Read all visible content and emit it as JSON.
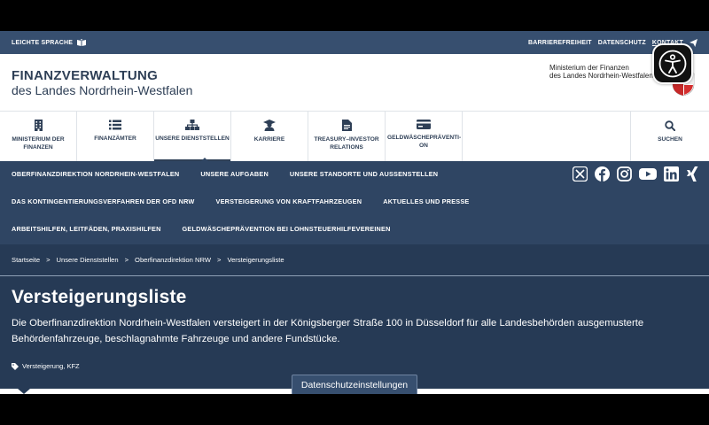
{
  "utility": {
    "easy_language": "LEICHTE SPRACHE",
    "accessibility": "BARRIEREFREIHEIT",
    "privacy": "DATENSCHUTZ",
    "contact": "KONTAKT"
  },
  "brand": {
    "line1": "FINANZVERWALTUNG",
    "line2": "des Landes Nordrhein-Westfalen"
  },
  "ministry": {
    "line1": "Ministerium der Finanzen",
    "line2": "des Landes Nordrhein-Westfalen"
  },
  "main_nav": {
    "items": [
      {
        "label": "MINISTERIUM DER FINANZEN",
        "icon": "building-icon"
      },
      {
        "label": "FINANZÄMTER",
        "icon": "list-icon"
      },
      {
        "label": "UNSERE DIENSTSTELLEN",
        "icon": "org-chart-icon"
      },
      {
        "label": "KARRIERE",
        "icon": "graduate-icon"
      },
      {
        "label": "TREASURY–INVESTOR RELATIONS",
        "icon": "document-icon"
      },
      {
        "label": "GELDWÄSCHEPRÄVENTI- ON",
        "icon": "credit-card-icon"
      }
    ],
    "search": "SUCHEN"
  },
  "sub_nav": {
    "row1": [
      "OBERFINANZDIREKTION NORDRHEIN-WESTFALEN",
      "UNSERE AUFGABEN",
      "UNSERE STANDORTE UND AUSSENSTELLEN"
    ],
    "row2": [
      "DAS KONTINGENTIERUNGSVERFAHREN DER OFD NRW",
      "VERSTEIGERUNG VON KRAFTFAHRZEUGEN",
      "AKTUELLES UND PRESSE"
    ],
    "row3": [
      "ARBEITSHILFEN, LEITFÄDEN, PRAXISHILFEN",
      "GELDWÄSCHEPRÄVENTION BEI LOHNSTEUERHILFEVEREINEN"
    ]
  },
  "breadcrumb": [
    "Startseite",
    "Unsere Dienststellen",
    "Oberfinanzdirektion NRW",
    "Versteigerungsliste"
  ],
  "page": {
    "title": "Versteigerungsliste",
    "intro": "Die Oberfinanzdirektion Nordrhein-Westfalen versteigert in der Königsberger Straße 100 in Düsseldorf für alle Landesbehörden ausgemusterte Behördenfahrzeuge, beschlagnahmte Fahrzeuge und andere Fundstücke.",
    "tags": "Versteigerung, KFZ"
  },
  "cookie_button": "Datenschutzeinstellungen",
  "colors": {
    "utility_bar": "#374f6f",
    "sub_nav": "#2f4563",
    "hero": "#263a55",
    "text_dark": "#2e3f56"
  }
}
